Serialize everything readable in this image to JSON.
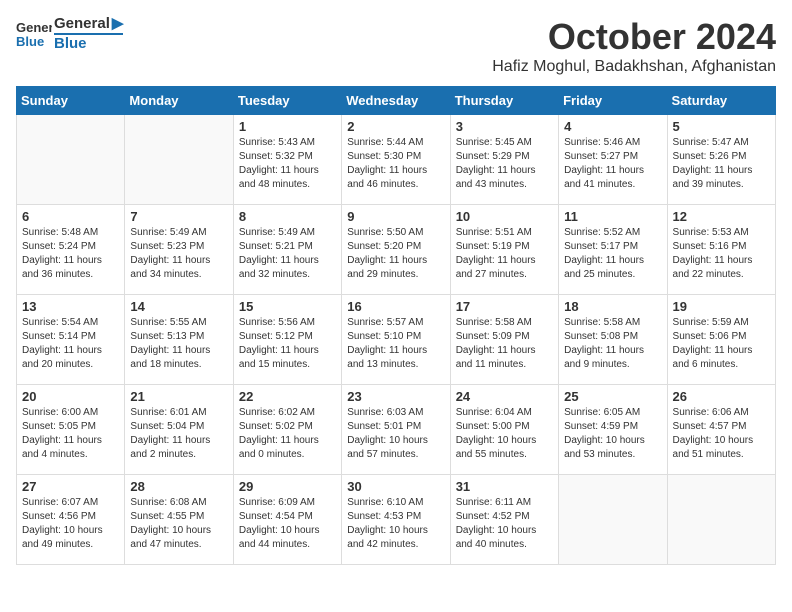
{
  "logo": {
    "line1": "General",
    "line2": "Blue"
  },
  "title": "October 2024",
  "location": "Hafiz Moghul, Badakhshan, Afghanistan",
  "days_of_week": [
    "Sunday",
    "Monday",
    "Tuesday",
    "Wednesday",
    "Thursday",
    "Friday",
    "Saturday"
  ],
  "weeks": [
    [
      {
        "day": "",
        "info": ""
      },
      {
        "day": "",
        "info": ""
      },
      {
        "day": "1",
        "info": "Sunrise: 5:43 AM\nSunset: 5:32 PM\nDaylight: 11 hours and 48 minutes."
      },
      {
        "day": "2",
        "info": "Sunrise: 5:44 AM\nSunset: 5:30 PM\nDaylight: 11 hours and 46 minutes."
      },
      {
        "day": "3",
        "info": "Sunrise: 5:45 AM\nSunset: 5:29 PM\nDaylight: 11 hours and 43 minutes."
      },
      {
        "day": "4",
        "info": "Sunrise: 5:46 AM\nSunset: 5:27 PM\nDaylight: 11 hours and 41 minutes."
      },
      {
        "day": "5",
        "info": "Sunrise: 5:47 AM\nSunset: 5:26 PM\nDaylight: 11 hours and 39 minutes."
      }
    ],
    [
      {
        "day": "6",
        "info": "Sunrise: 5:48 AM\nSunset: 5:24 PM\nDaylight: 11 hours and 36 minutes."
      },
      {
        "day": "7",
        "info": "Sunrise: 5:49 AM\nSunset: 5:23 PM\nDaylight: 11 hours and 34 minutes."
      },
      {
        "day": "8",
        "info": "Sunrise: 5:49 AM\nSunset: 5:21 PM\nDaylight: 11 hours and 32 minutes."
      },
      {
        "day": "9",
        "info": "Sunrise: 5:50 AM\nSunset: 5:20 PM\nDaylight: 11 hours and 29 minutes."
      },
      {
        "day": "10",
        "info": "Sunrise: 5:51 AM\nSunset: 5:19 PM\nDaylight: 11 hours and 27 minutes."
      },
      {
        "day": "11",
        "info": "Sunrise: 5:52 AM\nSunset: 5:17 PM\nDaylight: 11 hours and 25 minutes."
      },
      {
        "day": "12",
        "info": "Sunrise: 5:53 AM\nSunset: 5:16 PM\nDaylight: 11 hours and 22 minutes."
      }
    ],
    [
      {
        "day": "13",
        "info": "Sunrise: 5:54 AM\nSunset: 5:14 PM\nDaylight: 11 hours and 20 minutes."
      },
      {
        "day": "14",
        "info": "Sunrise: 5:55 AM\nSunset: 5:13 PM\nDaylight: 11 hours and 18 minutes."
      },
      {
        "day": "15",
        "info": "Sunrise: 5:56 AM\nSunset: 5:12 PM\nDaylight: 11 hours and 15 minutes."
      },
      {
        "day": "16",
        "info": "Sunrise: 5:57 AM\nSunset: 5:10 PM\nDaylight: 11 hours and 13 minutes."
      },
      {
        "day": "17",
        "info": "Sunrise: 5:58 AM\nSunset: 5:09 PM\nDaylight: 11 hours and 11 minutes."
      },
      {
        "day": "18",
        "info": "Sunrise: 5:58 AM\nSunset: 5:08 PM\nDaylight: 11 hours and 9 minutes."
      },
      {
        "day": "19",
        "info": "Sunrise: 5:59 AM\nSunset: 5:06 PM\nDaylight: 11 hours and 6 minutes."
      }
    ],
    [
      {
        "day": "20",
        "info": "Sunrise: 6:00 AM\nSunset: 5:05 PM\nDaylight: 11 hours and 4 minutes."
      },
      {
        "day": "21",
        "info": "Sunrise: 6:01 AM\nSunset: 5:04 PM\nDaylight: 11 hours and 2 minutes."
      },
      {
        "day": "22",
        "info": "Sunrise: 6:02 AM\nSunset: 5:02 PM\nDaylight: 11 hours and 0 minutes."
      },
      {
        "day": "23",
        "info": "Sunrise: 6:03 AM\nSunset: 5:01 PM\nDaylight: 10 hours and 57 minutes."
      },
      {
        "day": "24",
        "info": "Sunrise: 6:04 AM\nSunset: 5:00 PM\nDaylight: 10 hours and 55 minutes."
      },
      {
        "day": "25",
        "info": "Sunrise: 6:05 AM\nSunset: 4:59 PM\nDaylight: 10 hours and 53 minutes."
      },
      {
        "day": "26",
        "info": "Sunrise: 6:06 AM\nSunset: 4:57 PM\nDaylight: 10 hours and 51 minutes."
      }
    ],
    [
      {
        "day": "27",
        "info": "Sunrise: 6:07 AM\nSunset: 4:56 PM\nDaylight: 10 hours and 49 minutes."
      },
      {
        "day": "28",
        "info": "Sunrise: 6:08 AM\nSunset: 4:55 PM\nDaylight: 10 hours and 47 minutes."
      },
      {
        "day": "29",
        "info": "Sunrise: 6:09 AM\nSunset: 4:54 PM\nDaylight: 10 hours and 44 minutes."
      },
      {
        "day": "30",
        "info": "Sunrise: 6:10 AM\nSunset: 4:53 PM\nDaylight: 10 hours and 42 minutes."
      },
      {
        "day": "31",
        "info": "Sunrise: 6:11 AM\nSunset: 4:52 PM\nDaylight: 10 hours and 40 minutes."
      },
      {
        "day": "",
        "info": ""
      },
      {
        "day": "",
        "info": ""
      }
    ]
  ]
}
